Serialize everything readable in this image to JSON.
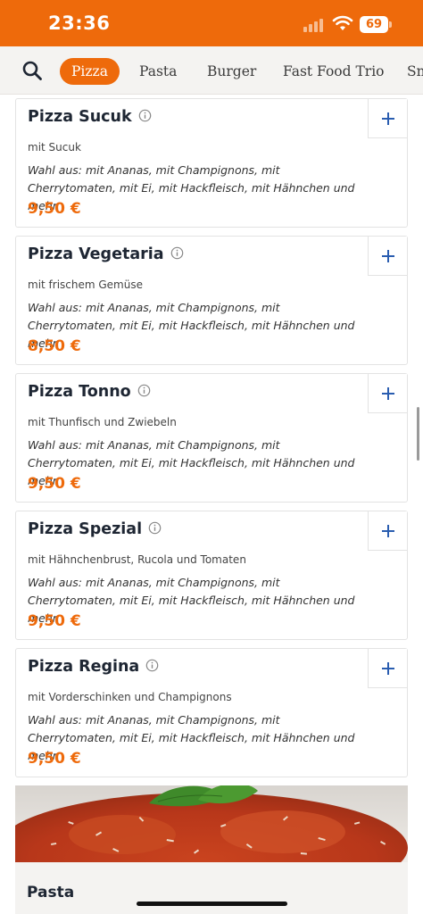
{
  "status": {
    "time": "23:36",
    "battery": "69"
  },
  "colors": {
    "accent": "#ee6a0b",
    "title": "#1e2633",
    "plus": "#2a5db0"
  },
  "categories": [
    {
      "label": "Pizza",
      "active": true
    },
    {
      "label": "Pasta",
      "active": false
    },
    {
      "label": "Burger",
      "active": false
    },
    {
      "label": "Fast Food Trio",
      "active": false
    },
    {
      "label": "Sn",
      "active": false
    }
  ],
  "items": [
    {
      "name": "Pizza Sucuk",
      "desc": "mit Sucuk",
      "choice": "Wahl aus: mit Ananas, mit Champignons, mit Cherrytomaten, mit Ei, mit Hackfleisch, mit Hähnchen und mehr.",
      "price": "9,50 €"
    },
    {
      "name": "Pizza Vegetaria",
      "desc": "mit frischem Gemüse",
      "choice": "Wahl aus: mit Ananas, mit Champignons, mit Cherrytomaten, mit Ei, mit Hackfleisch, mit Hähnchen und mehr.",
      "price": "8,50 €"
    },
    {
      "name": "Pizza Tonno",
      "desc": "mit Thunfisch und Zwiebeln",
      "choice": "Wahl aus: mit Ananas, mit Champignons, mit Cherrytomaten, mit Ei, mit Hackfleisch, mit Hähnchen und mehr.",
      "price": "9,50 €"
    },
    {
      "name": "Pizza Spezial",
      "desc": "mit Hähnchenbrust, Rucola und Tomaten",
      "choice": "Wahl aus: mit Ananas, mit Champignons, mit Cherrytomaten, mit Ei, mit Hackfleisch, mit Hähnchen und mehr.",
      "price": "9,50 €"
    },
    {
      "name": "Pizza Regina",
      "desc": "mit Vorderschinken und Champignons",
      "choice": "Wahl aus: mit Ananas, mit Champignons, mit Cherrytomaten, mit Ei, mit Hackfleisch, mit Hähnchen und mehr.",
      "price": "9,50 €"
    }
  ],
  "next_category": {
    "title": "Pasta"
  },
  "icons": {
    "search": "search-icon",
    "info": "info-icon",
    "add": "plus-icon"
  }
}
